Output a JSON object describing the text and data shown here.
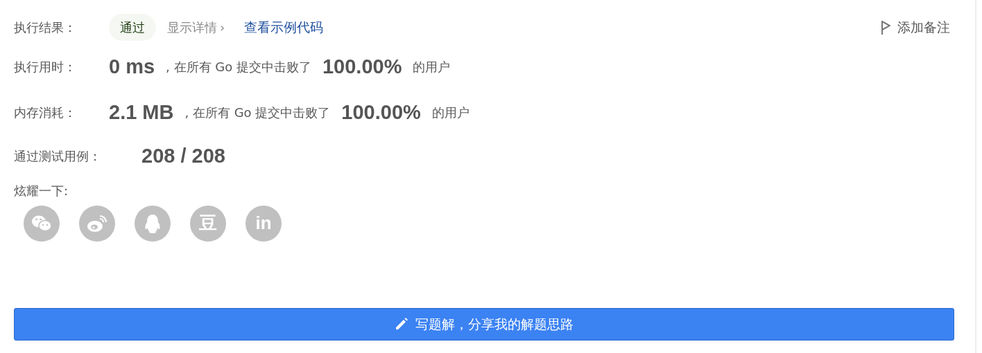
{
  "result": {
    "label": "执行结果：",
    "status": "通过",
    "details_link": "显示详情",
    "details_caret": "›",
    "sample_link": "查看示例代码",
    "note_button": "添加备注"
  },
  "stats": [
    {
      "label": "执行用时：",
      "value": "0 ms",
      "middle": ", 在所有 Go 提交中击败了",
      "percent": "100.00%",
      "suffix": "的用户"
    },
    {
      "label": "内存消耗：",
      "value": "2.1 MB",
      "middle": ", 在所有 Go 提交中击败了",
      "percent": "100.00%",
      "suffix": "的用户"
    }
  ],
  "tests": {
    "label": "通过测试用例：",
    "value": "208 / 208"
  },
  "share": {
    "label": "炫耀一下:",
    "buttons": [
      {
        "kind": "wechat"
      },
      {
        "kind": "weibo"
      },
      {
        "kind": "qq"
      },
      {
        "kind": "douban",
        "glyph": "豆"
      },
      {
        "kind": "linkedin",
        "glyph": "in"
      }
    ]
  },
  "write_button": "写题解，分享我的解题思路"
}
